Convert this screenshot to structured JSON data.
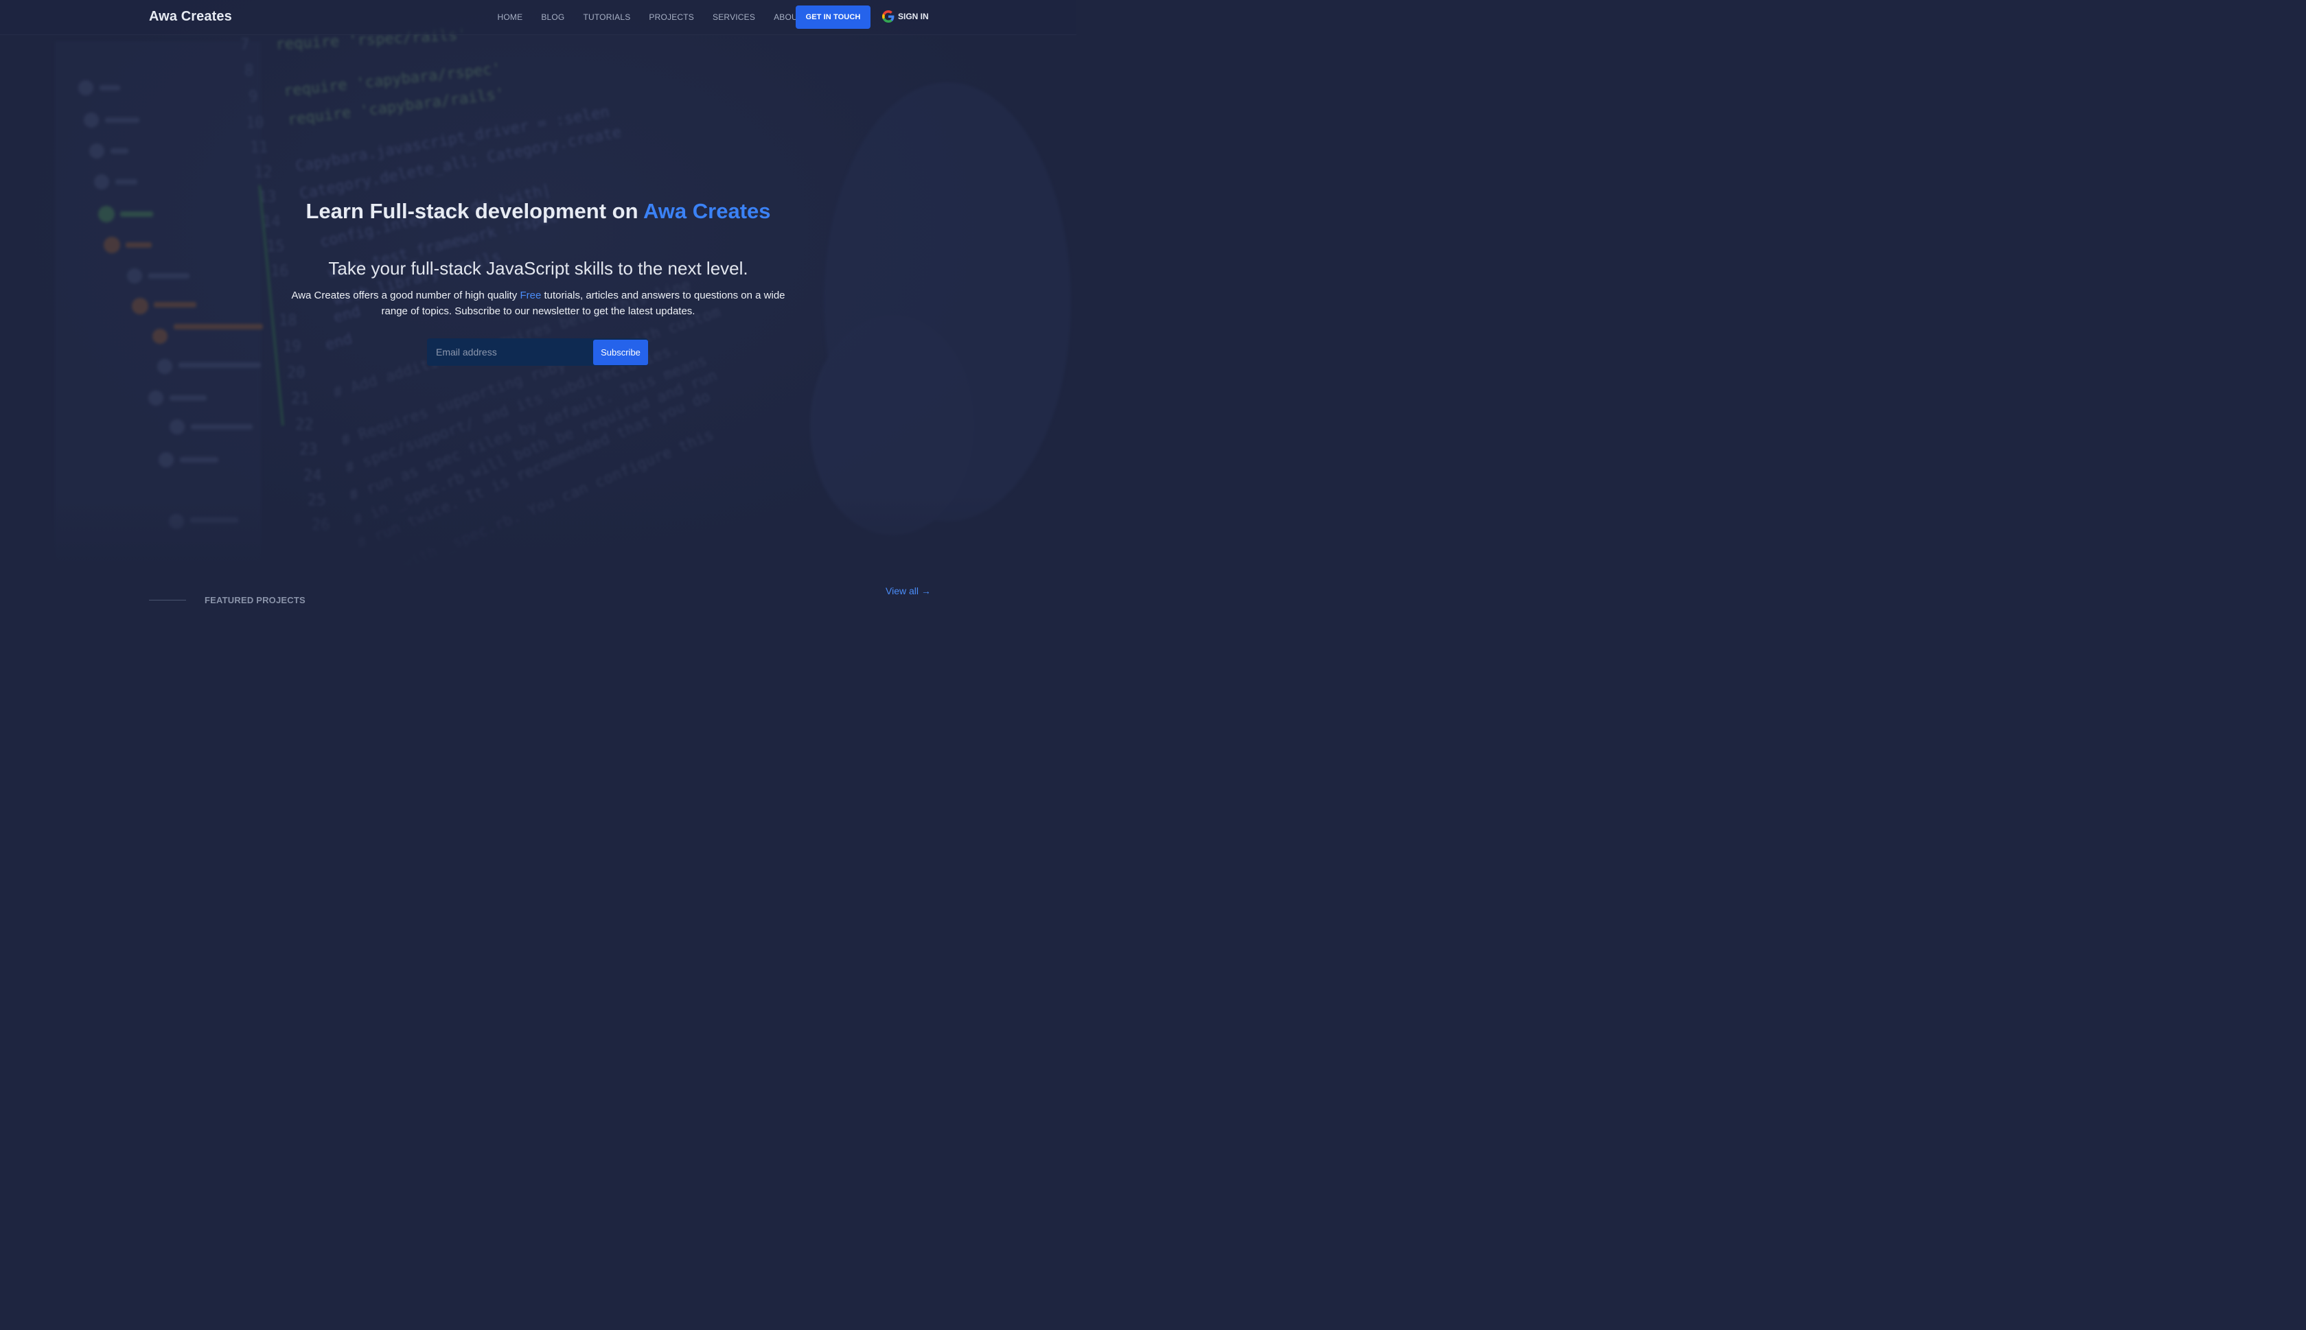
{
  "header": {
    "brand": "Awa Creates",
    "nav": [
      {
        "label": "HOME"
      },
      {
        "label": "BLOG"
      },
      {
        "label": "TUTORIALS"
      },
      {
        "label": "PROJECTS"
      },
      {
        "label": "SERVICES"
      },
      {
        "label": "ABOUT"
      }
    ],
    "cta_label": "GET IN TOUCH",
    "signin_label": "SIGN IN"
  },
  "hero": {
    "headline_prefix": "Learn Full-stack development on ",
    "headline_accent": "Awa Creates",
    "subheadline": "Take your full-stack JavaScript skills to the next level.",
    "description_before": "Awa Creates offers a good number of high quality ",
    "description_highlight": "Free",
    "description_after": " tutorials, articles and answers to questions on a wide range of topics. Subscribe to our newsletter to get the latest updates.",
    "email_placeholder": "Email address",
    "subscribe_label": "Subscribe"
  },
  "featured": {
    "title": "FEATURED PROJECTS",
    "view_all": "View all →"
  },
  "colors": {
    "background": "#1e2540",
    "accent": "#2563eb",
    "accent_text": "#3b82f6"
  }
}
